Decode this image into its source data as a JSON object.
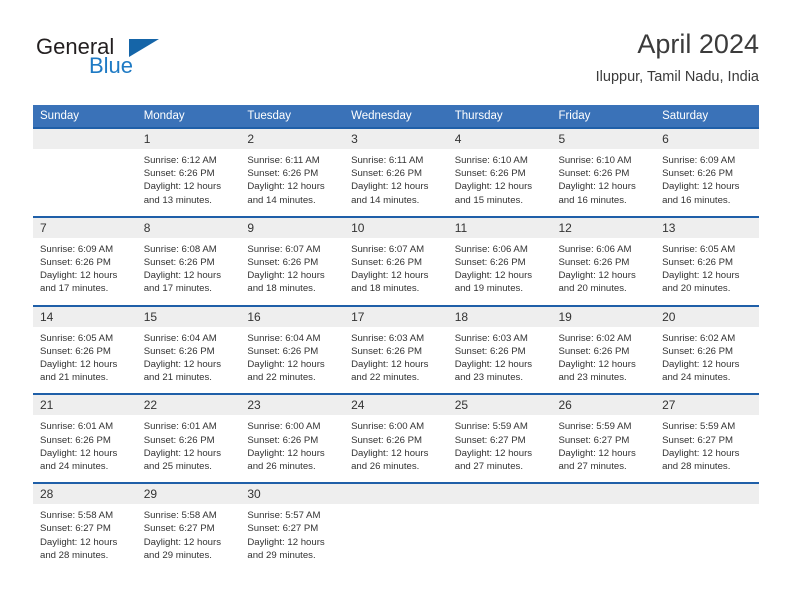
{
  "brand": {
    "name_part1": "General",
    "name_part2": "Blue",
    "triangle_icon": "brand-triangle-icon"
  },
  "header": {
    "title": "April 2024",
    "subtitle": "Iluppur, Tamil Nadu, India"
  },
  "calendar": {
    "weekday_headers": [
      "Sunday",
      "Monday",
      "Tuesday",
      "Wednesday",
      "Thursday",
      "Friday",
      "Saturday"
    ],
    "colors": {
      "header_bar": "#3a72b8",
      "week_separator": "#1f5fa8",
      "daynum_band": "#eeeeee",
      "brand_blue": "#1e7ac4",
      "text": "#333333"
    },
    "weeks": [
      {
        "days": [
          {
            "num": "",
            "sunrise": "",
            "sunset": "",
            "daylight": ""
          },
          {
            "num": "1",
            "sunrise": "Sunrise: 6:12 AM",
            "sunset": "Sunset: 6:26 PM",
            "daylight": "Daylight: 12 hours and 13 minutes."
          },
          {
            "num": "2",
            "sunrise": "Sunrise: 6:11 AM",
            "sunset": "Sunset: 6:26 PM",
            "daylight": "Daylight: 12 hours and 14 minutes."
          },
          {
            "num": "3",
            "sunrise": "Sunrise: 6:11 AM",
            "sunset": "Sunset: 6:26 PM",
            "daylight": "Daylight: 12 hours and 14 minutes."
          },
          {
            "num": "4",
            "sunrise": "Sunrise: 6:10 AM",
            "sunset": "Sunset: 6:26 PM",
            "daylight": "Daylight: 12 hours and 15 minutes."
          },
          {
            "num": "5",
            "sunrise": "Sunrise: 6:10 AM",
            "sunset": "Sunset: 6:26 PM",
            "daylight": "Daylight: 12 hours and 16 minutes."
          },
          {
            "num": "6",
            "sunrise": "Sunrise: 6:09 AM",
            "sunset": "Sunset: 6:26 PM",
            "daylight": "Daylight: 12 hours and 16 minutes."
          }
        ]
      },
      {
        "days": [
          {
            "num": "7",
            "sunrise": "Sunrise: 6:09 AM",
            "sunset": "Sunset: 6:26 PM",
            "daylight": "Daylight: 12 hours and 17 minutes."
          },
          {
            "num": "8",
            "sunrise": "Sunrise: 6:08 AM",
            "sunset": "Sunset: 6:26 PM",
            "daylight": "Daylight: 12 hours and 17 minutes."
          },
          {
            "num": "9",
            "sunrise": "Sunrise: 6:07 AM",
            "sunset": "Sunset: 6:26 PM",
            "daylight": "Daylight: 12 hours and 18 minutes."
          },
          {
            "num": "10",
            "sunrise": "Sunrise: 6:07 AM",
            "sunset": "Sunset: 6:26 PM",
            "daylight": "Daylight: 12 hours and 18 minutes."
          },
          {
            "num": "11",
            "sunrise": "Sunrise: 6:06 AM",
            "sunset": "Sunset: 6:26 PM",
            "daylight": "Daylight: 12 hours and 19 minutes."
          },
          {
            "num": "12",
            "sunrise": "Sunrise: 6:06 AM",
            "sunset": "Sunset: 6:26 PM",
            "daylight": "Daylight: 12 hours and 20 minutes."
          },
          {
            "num": "13",
            "sunrise": "Sunrise: 6:05 AM",
            "sunset": "Sunset: 6:26 PM",
            "daylight": "Daylight: 12 hours and 20 minutes."
          }
        ]
      },
      {
        "days": [
          {
            "num": "14",
            "sunrise": "Sunrise: 6:05 AM",
            "sunset": "Sunset: 6:26 PM",
            "daylight": "Daylight: 12 hours and 21 minutes."
          },
          {
            "num": "15",
            "sunrise": "Sunrise: 6:04 AM",
            "sunset": "Sunset: 6:26 PM",
            "daylight": "Daylight: 12 hours and 21 minutes."
          },
          {
            "num": "16",
            "sunrise": "Sunrise: 6:04 AM",
            "sunset": "Sunset: 6:26 PM",
            "daylight": "Daylight: 12 hours and 22 minutes."
          },
          {
            "num": "17",
            "sunrise": "Sunrise: 6:03 AM",
            "sunset": "Sunset: 6:26 PM",
            "daylight": "Daylight: 12 hours and 22 minutes."
          },
          {
            "num": "18",
            "sunrise": "Sunrise: 6:03 AM",
            "sunset": "Sunset: 6:26 PM",
            "daylight": "Daylight: 12 hours and 23 minutes."
          },
          {
            "num": "19",
            "sunrise": "Sunrise: 6:02 AM",
            "sunset": "Sunset: 6:26 PM",
            "daylight": "Daylight: 12 hours and 23 minutes."
          },
          {
            "num": "20",
            "sunrise": "Sunrise: 6:02 AM",
            "sunset": "Sunset: 6:26 PM",
            "daylight": "Daylight: 12 hours and 24 minutes."
          }
        ]
      },
      {
        "days": [
          {
            "num": "21",
            "sunrise": "Sunrise: 6:01 AM",
            "sunset": "Sunset: 6:26 PM",
            "daylight": "Daylight: 12 hours and 24 minutes."
          },
          {
            "num": "22",
            "sunrise": "Sunrise: 6:01 AM",
            "sunset": "Sunset: 6:26 PM",
            "daylight": "Daylight: 12 hours and 25 minutes."
          },
          {
            "num": "23",
            "sunrise": "Sunrise: 6:00 AM",
            "sunset": "Sunset: 6:26 PM",
            "daylight": "Daylight: 12 hours and 26 minutes."
          },
          {
            "num": "24",
            "sunrise": "Sunrise: 6:00 AM",
            "sunset": "Sunset: 6:26 PM",
            "daylight": "Daylight: 12 hours and 26 minutes."
          },
          {
            "num": "25",
            "sunrise": "Sunrise: 5:59 AM",
            "sunset": "Sunset: 6:27 PM",
            "daylight": "Daylight: 12 hours and 27 minutes."
          },
          {
            "num": "26",
            "sunrise": "Sunrise: 5:59 AM",
            "sunset": "Sunset: 6:27 PM",
            "daylight": "Daylight: 12 hours and 27 minutes."
          },
          {
            "num": "27",
            "sunrise": "Sunrise: 5:59 AM",
            "sunset": "Sunset: 6:27 PM",
            "daylight": "Daylight: 12 hours and 28 minutes."
          }
        ]
      },
      {
        "days": [
          {
            "num": "28",
            "sunrise": "Sunrise: 5:58 AM",
            "sunset": "Sunset: 6:27 PM",
            "daylight": "Daylight: 12 hours and 28 minutes."
          },
          {
            "num": "29",
            "sunrise": "Sunrise: 5:58 AM",
            "sunset": "Sunset: 6:27 PM",
            "daylight": "Daylight: 12 hours and 29 minutes."
          },
          {
            "num": "30",
            "sunrise": "Sunrise: 5:57 AM",
            "sunset": "Sunset: 6:27 PM",
            "daylight": "Daylight: 12 hours and 29 minutes."
          },
          {
            "num": "",
            "sunrise": "",
            "sunset": "",
            "daylight": ""
          },
          {
            "num": "",
            "sunrise": "",
            "sunset": "",
            "daylight": ""
          },
          {
            "num": "",
            "sunrise": "",
            "sunset": "",
            "daylight": ""
          },
          {
            "num": "",
            "sunrise": "",
            "sunset": "",
            "daylight": ""
          }
        ]
      }
    ]
  }
}
